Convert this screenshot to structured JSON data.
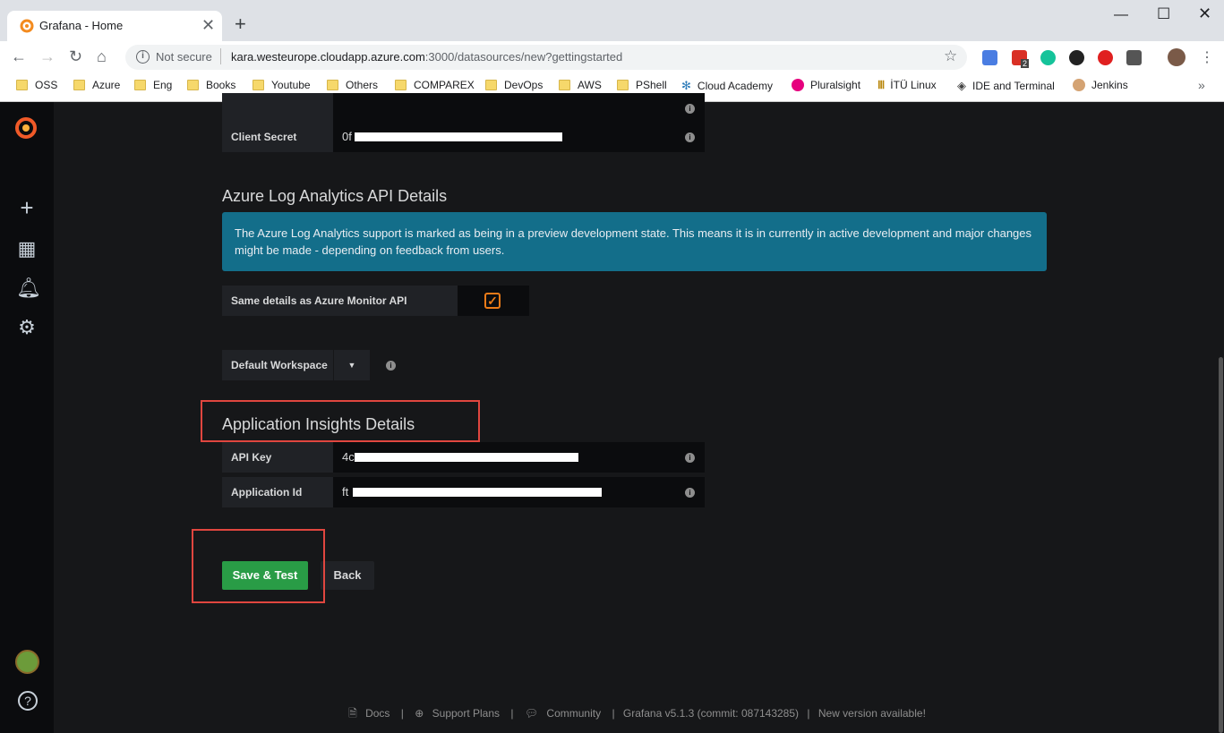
{
  "browser": {
    "tab_title": "Grafana - Home",
    "not_secure": "Not secure",
    "url_host": "kara.westeurope.cloudapp.azure.com",
    "url_path": ":3000/datasources/new?gettingstarted",
    "ext_badge": "2",
    "bookmarks": [
      "OSS",
      "Azure",
      "Eng",
      "Books",
      "Youtube",
      "Others",
      "COMPAREX",
      "DevOps",
      "AWS",
      "PShell",
      "Cloud Academy",
      "Pluralsight",
      "İTÜ Linux",
      "IDE and Terminal",
      "Jenkins"
    ]
  },
  "form": {
    "client_secret_label": "Client Secret",
    "client_secret_value": "0f",
    "log_analytics_title": "Azure Log Analytics API Details",
    "alert_text": "The Azure Log Analytics support is marked as being in a preview development state. This means it is in currently in active development and major changes might be made - depending on feedback from users.",
    "same_details_label": "Same details as Azure Monitor API",
    "default_workspace_label": "Default Workspace",
    "app_insights_title": "Application Insights Details",
    "api_key_label": "API Key",
    "api_key_value": "4c",
    "app_id_label": "Application Id",
    "app_id_value": "ft",
    "save_test_label": "Save & Test",
    "back_label": "Back"
  },
  "footer": {
    "docs": "Docs",
    "support": "Support Plans",
    "community": "Community",
    "version": "Grafana v5.1.3 (commit: 087143285)",
    "new_version": "New version available!",
    "sep": "|"
  },
  "colors": {
    "accent_orange": "#eb7b18",
    "alert_blue": "#136e8a",
    "success_green": "#299c46",
    "highlight_red": "#e0463f"
  }
}
